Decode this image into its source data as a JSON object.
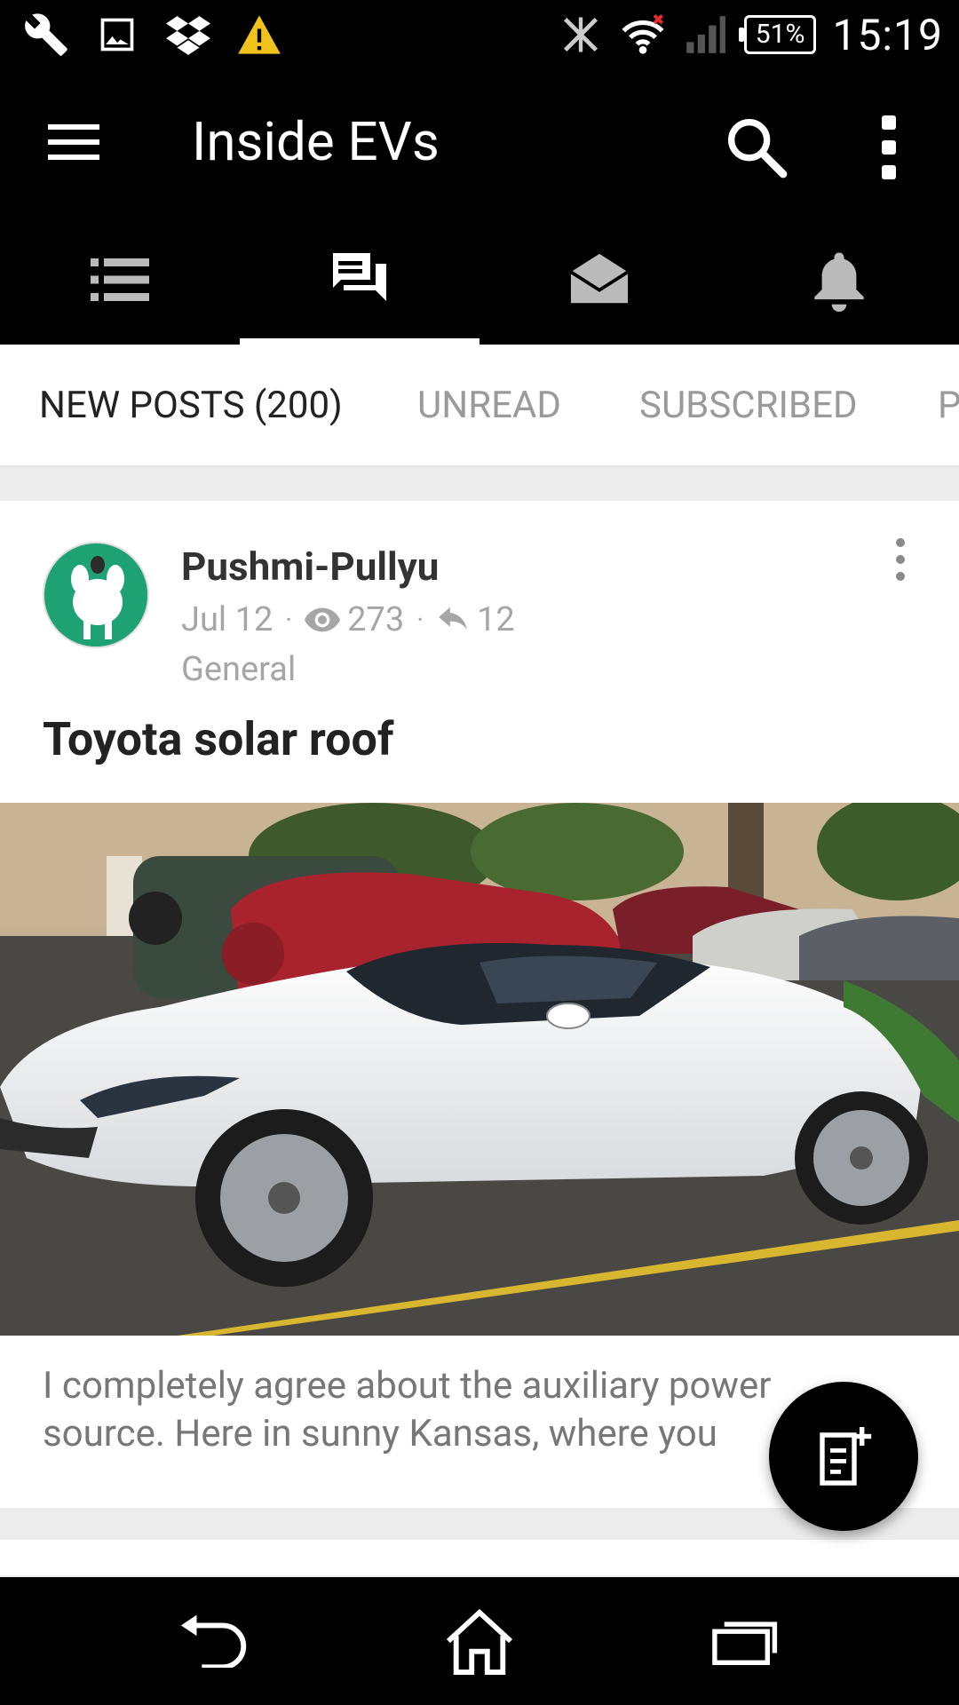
{
  "status_bar": {
    "icons_left": [
      "wrench-icon",
      "image-icon",
      "dropbox-icon",
      "warning-icon"
    ],
    "icons_right": [
      "nfc-off-icon",
      "wifi-icon",
      "signal-icon"
    ],
    "battery": "51%",
    "time": "15:19"
  },
  "app_bar": {
    "title": "Inside EVs",
    "icons": [
      "menu-icon",
      "search-icon",
      "more-vert-icon"
    ]
  },
  "icon_tabs": {
    "items": [
      "list-icon",
      "forum-icon",
      "mail-open-icon",
      "bell-icon"
    ],
    "active_index": 1
  },
  "text_tabs": {
    "items": [
      "NEW POSTS (200)",
      "UNREAD",
      "SUBSCRIBED",
      "P"
    ],
    "active_index": 0
  },
  "post": {
    "author": "Pushmi-Pullyu",
    "date": "Jul 12",
    "views": "273",
    "replies": "12",
    "forum": "General",
    "title": "Toyota solar roof",
    "excerpt_line1": "I completely agree about the auxiliary power",
    "excerpt_line2": "source. Here in sunny Kansas, where you",
    "image_subject": "white sports car parked in a parking lot"
  },
  "fab": {
    "icon": "new-post-icon"
  },
  "nav_bar": {
    "icons": [
      "back-icon",
      "home-icon",
      "recents-icon"
    ]
  },
  "colors": {
    "bar_background": "#000000",
    "tab_active_text": "#222222",
    "tab_inactive_text": "#9a9a9a",
    "meta_text": "#a6a6a6",
    "avatar_green": "#1fa273",
    "page_background": "#ececec"
  }
}
